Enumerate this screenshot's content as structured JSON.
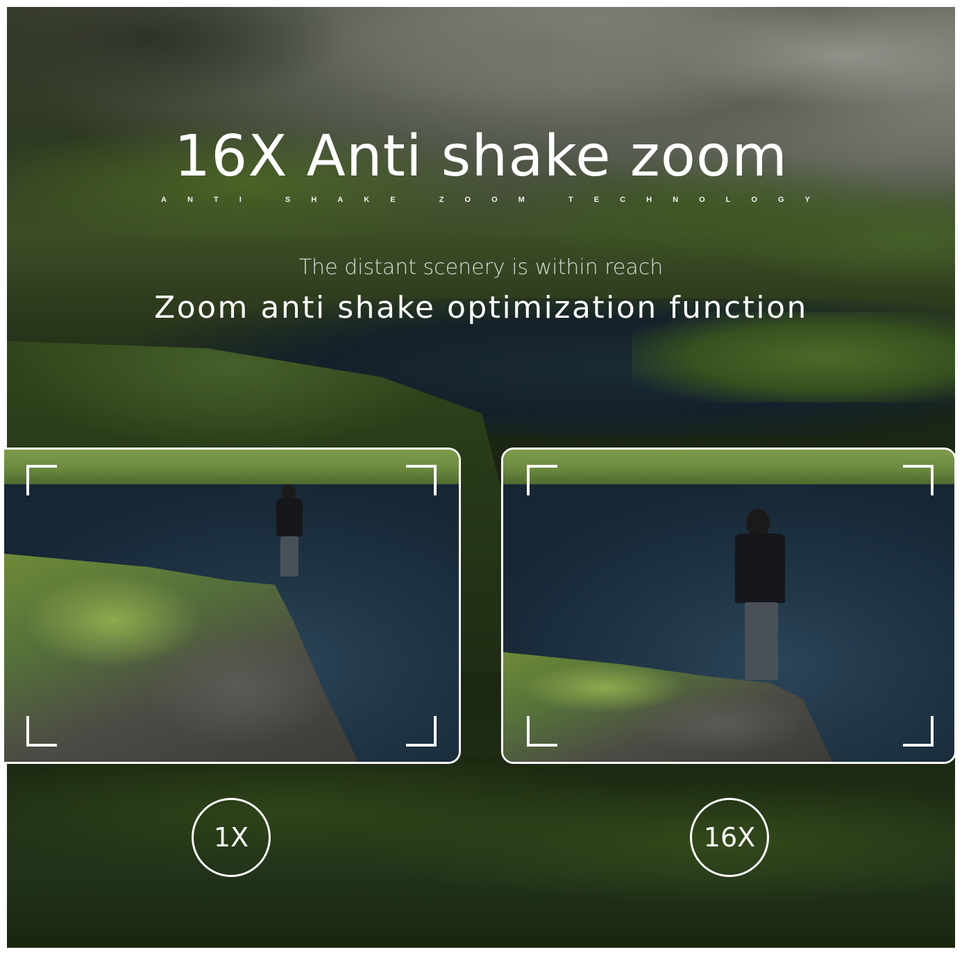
{
  "headline": "16X Anti shake zoom",
  "subtag_letters": [
    "A",
    "N",
    "T",
    "I",
    "",
    "S",
    "H",
    "A",
    "K",
    "E",
    "",
    "Z",
    "O",
    "O",
    "M",
    "",
    "T",
    "E",
    "C",
    "H",
    "N",
    "O",
    "L",
    "O",
    "G",
    "Y"
  ],
  "tagline": "The distant scenery is within reach",
  "feature": "Zoom anti shake optimization function",
  "comparison": {
    "left": {
      "badge": "1X"
    },
    "right": {
      "badge": "16X"
    }
  },
  "colors": {
    "text": "#ffffff",
    "frame_border": "#ffffff",
    "tagline": "#d9dbd6"
  }
}
